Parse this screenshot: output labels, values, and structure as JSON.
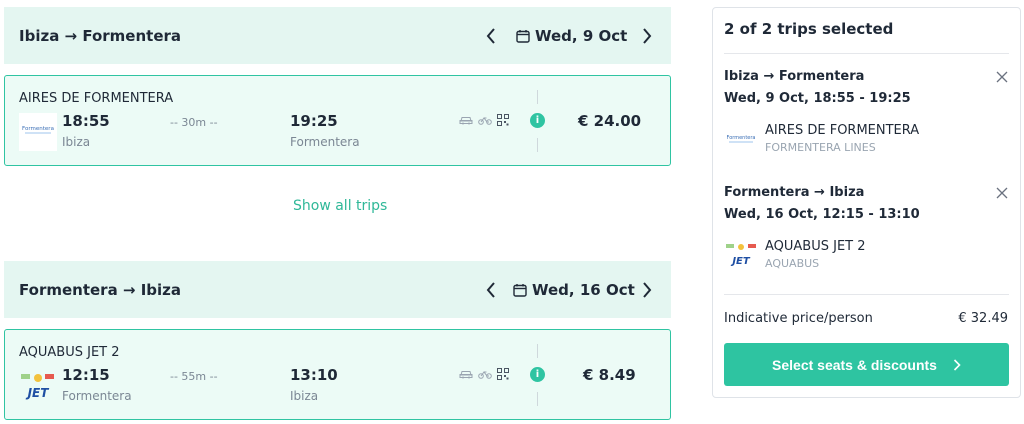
{
  "outbound": {
    "route": "Ibiza → Formentera",
    "date": "Wed, 9 Oct",
    "trip": {
      "operator": "AIRES DE FORMENTERA",
      "logo_text": "Formentera",
      "dep_time": "18:55",
      "dep_city": "Ibiza",
      "duration": "-- 30m --",
      "arr_time": "19:25",
      "arr_city": "Formentera",
      "price": "€ 24.00"
    }
  },
  "show_all_label": "Show all trips",
  "inbound": {
    "route": "Formentera → Ibiza",
    "date": "Wed, 16 Oct",
    "trip": {
      "operator": "AQUABUS JET 2",
      "logo_text": "JET",
      "dep_time": "12:15",
      "dep_city": "Formentera",
      "duration": "-- 55m --",
      "arr_time": "13:10",
      "arr_city": "Ibiza",
      "price": "€ 8.49"
    }
  },
  "summary": {
    "title": "2 of 2 trips selected",
    "trips": [
      {
        "route": "Ibiza → Formentera",
        "when": "Wed, 9 Oct, 18:55 - 19:25",
        "operator": "AIRES DE FORMENTERA",
        "company": "FORMENTERA LINES",
        "logo_text": "Formentera"
      },
      {
        "route": "Formentera → Ibiza",
        "when": "Wed, 16 Oct, 12:15 - 13:10",
        "operator": "AQUABUS JET 2",
        "company": "AQUABUS",
        "logo_text": "JET"
      }
    ],
    "price_label": "Indicative price/person",
    "price_value": "€ 32.49",
    "cta_label": "Select seats & discounts"
  },
  "colors": {
    "accent": "#2ec4a1",
    "header_bg": "#e4f6f1",
    "card_bg": "#ecfbf6"
  },
  "info_glyph": "i"
}
